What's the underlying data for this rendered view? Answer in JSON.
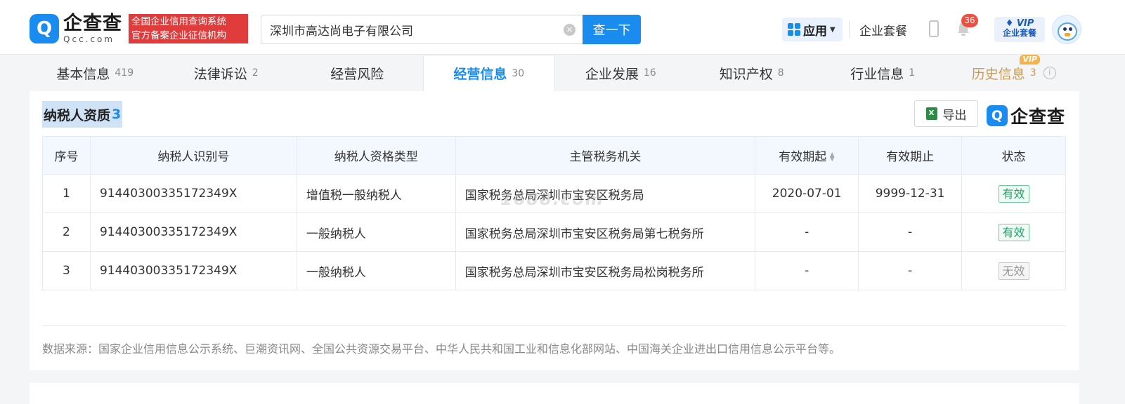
{
  "header": {
    "logo_cn": "企查查",
    "logo_en": "Qcc.com",
    "slogan_line1": "全国企业信用查询系统",
    "slogan_line2": "官方备案企业征信机构",
    "search_value": "深圳市高达尚电子有限公司",
    "search_button": "查一下",
    "apps_label": "应用",
    "package_label": "企业套餐",
    "notification_count": "36",
    "vip_line1": "VIP",
    "vip_line2": "企业套餐"
  },
  "tabs": [
    {
      "label": "基本信息",
      "count": "419"
    },
    {
      "label": "法律诉讼",
      "count": "2"
    },
    {
      "label": "经营风险",
      "count": ""
    },
    {
      "label": "经营信息",
      "count": "30"
    },
    {
      "label": "企业发展",
      "count": "16"
    },
    {
      "label": "知识产权",
      "count": "8"
    },
    {
      "label": "行业信息",
      "count": "1"
    },
    {
      "label": "历史信息",
      "count": "3",
      "tag": "VIP"
    }
  ],
  "section": {
    "title": "纳税人资质",
    "count": "3",
    "export_label": "导出",
    "brand_text": "企查查"
  },
  "table": {
    "headers": [
      "序号",
      "纳税人识别号",
      "纳税人资格类型",
      "主管税务机关",
      "有效期起",
      "有效期止",
      "状态"
    ],
    "rows": [
      {
        "index": "1",
        "tax_id": "91440300335172349X",
        "type": "增值税一般纳税人",
        "authority": "国家税务总局深圳市宝安区税务局",
        "start": "2020-07-01",
        "end": "9999-12-31",
        "status": "有效"
      },
      {
        "index": "2",
        "tax_id": "91440300335172349X",
        "type": "一般纳税人",
        "authority": "国家税务总局深圳市宝安区税务局第七税务所",
        "start": "-",
        "end": "-",
        "status": "有效"
      },
      {
        "index": "3",
        "tax_id": "91440300335172349X",
        "type": "一般纳税人",
        "authority": "国家税务总局深圳市宝安区税务局松岗税务所",
        "start": "-",
        "end": "-",
        "status": "无效"
      }
    ]
  },
  "watermark": "1688.com",
  "source_note": "数据来源：国家企业信用信息公示系统、巨潮资讯网、全国公共资源交易平台、中华人民共和国工业和信息化部网站、中国海关企业进出口信用信息公示平台等。",
  "colors": {
    "accent": "#1a8cf0",
    "valid": "#21a366",
    "slogan_bg": "#e03c3c",
    "history": "#c89a56"
  }
}
